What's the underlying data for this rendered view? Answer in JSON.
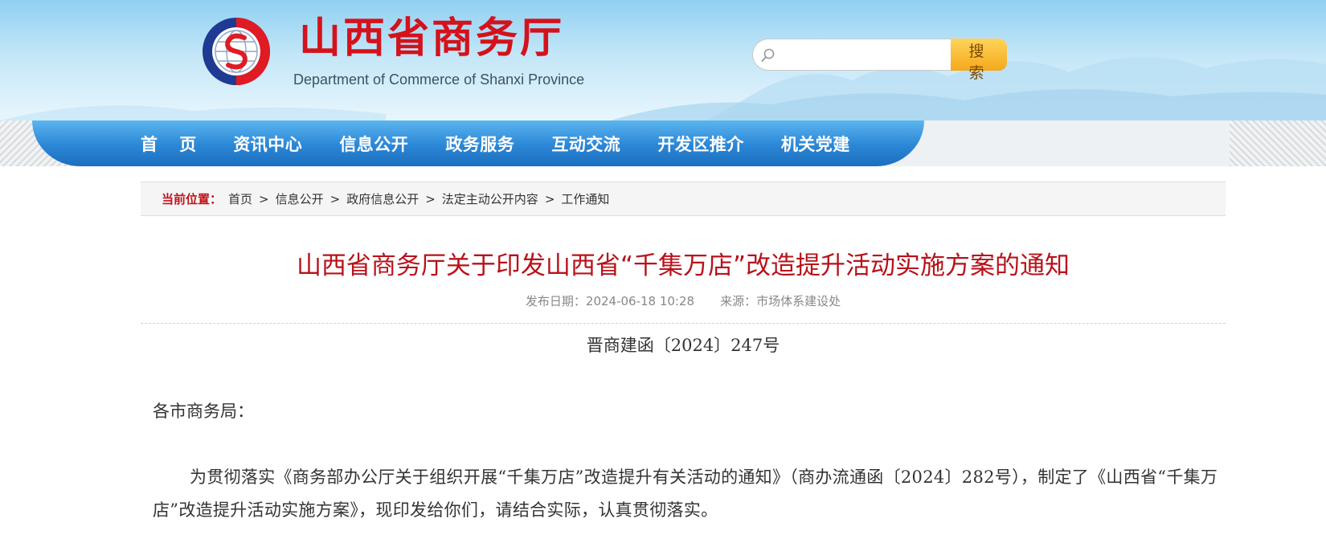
{
  "header": {
    "site_title": "山西省商务厅",
    "site_subtitle": "Department of Commerce of Shanxi Province",
    "search": {
      "placeholder": "",
      "value": "",
      "button_label": "搜 索"
    }
  },
  "nav": {
    "items": [
      {
        "label": "首 页"
      },
      {
        "label": "资讯中心"
      },
      {
        "label": "信息公开"
      },
      {
        "label": "政务服务"
      },
      {
        "label": "互动交流"
      },
      {
        "label": "开发区推介"
      },
      {
        "label": "机关党建"
      }
    ]
  },
  "breadcrumb": {
    "label": "当前位置：",
    "items": [
      "首页",
      "信息公开",
      "政府信息公开",
      "法定主动公开内容",
      "工作通知"
    ],
    "separator": ">"
  },
  "article": {
    "title": "山西省商务厅关于印发山西省“千集万店”改造提升活动实施方案的通知",
    "publish_date": "发布日期：2024-06-18 10:28",
    "source": "来源：市场体系建设处",
    "doc_number": "晋商建函〔2024〕247号",
    "salutation": "各市商务局：",
    "paragraph": "为贯彻落实《商务部办公厅关于组织开展“千集万店”改造提升有关活动的通知》（商办流通函〔2024〕282号），制定了《山西省“千集万店”改造提升活动实施方案》，现印发给你们，请结合实际，认真贯彻落实。"
  },
  "colors": {
    "brand_red": "#d4121b",
    "title_red": "#b8121a",
    "nav_blue": "#2b86d6",
    "search_orange": "#f4a91c"
  },
  "icons": {
    "logo": "commerce-emblem-icon",
    "search": "magnifier-icon"
  }
}
